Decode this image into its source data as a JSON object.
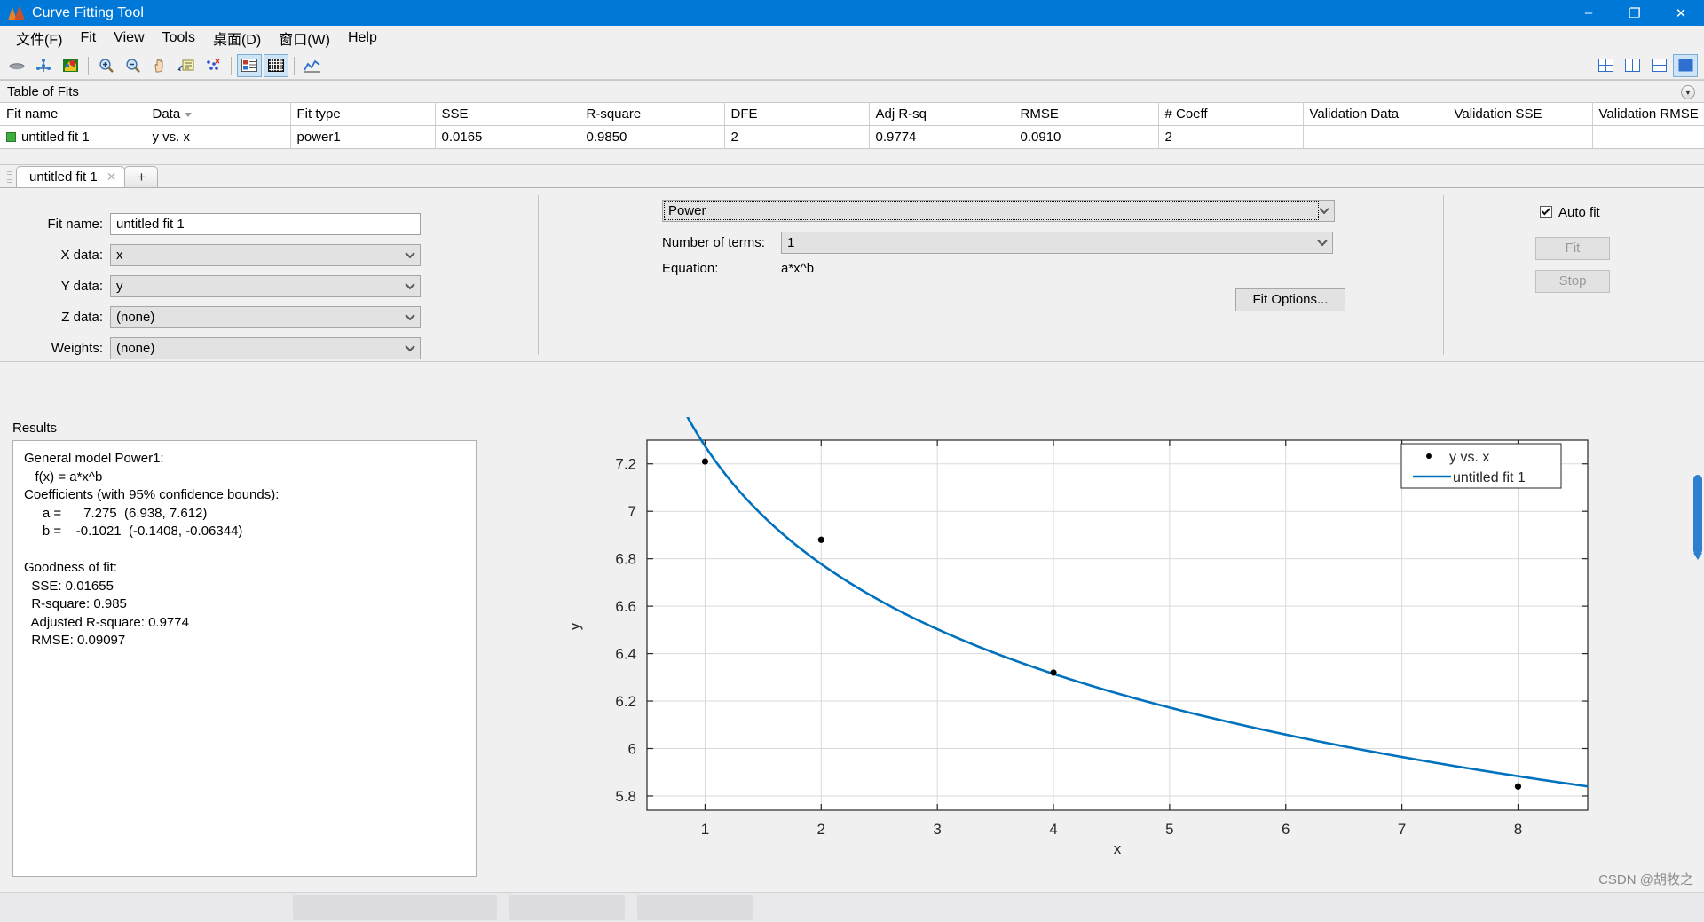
{
  "window": {
    "title": "Curve Fitting Tool",
    "icon": "matlab-icon",
    "minimize": "–",
    "maximize": "❐",
    "close": "✕"
  },
  "menubar": {
    "items": [
      {
        "label": "文件(F)",
        "name": "menu-file"
      },
      {
        "label": "Fit",
        "name": "menu-fit"
      },
      {
        "label": "View",
        "name": "menu-view"
      },
      {
        "label": "Tools",
        "name": "menu-tools"
      },
      {
        "label": "桌面(D)",
        "name": "menu-desktop"
      },
      {
        "label": "窗口(W)",
        "name": "menu-window"
      },
      {
        "label": "Help",
        "name": "menu-help"
      }
    ]
  },
  "toolbar": {
    "buttons": [
      "rotate-3d-icon",
      "data-cursor-icon",
      "colormap-icon",
      "zoom-in-icon",
      "zoom-out-icon",
      "pan-icon",
      "legend-icon",
      "exclude-outliers-icon",
      "table-of-fits-icon",
      "grid-icon",
      "residuals-plot-icon"
    ],
    "right_buttons": [
      "layout-grid-icon",
      "layout-two-columns-icon",
      "layout-two-rows-icon",
      "layout-single-icon"
    ]
  },
  "table_of_fits": {
    "panel_title": "Table of Fits",
    "collapse_icon": "chevron-down-icon",
    "columns": [
      "Fit name",
      "Data",
      "Fit type",
      "SSE",
      "R-square",
      "DFE",
      "Adj R-sq",
      "RMSE",
      "# Coeff",
      "Validation Data",
      "Validation SSE",
      "Validation RMSE"
    ],
    "sorted_column": "Data",
    "rows": [
      {
        "fit_name": "untitled fit 1",
        "data": "y vs. x",
        "fit_type": "power1",
        "sse": "0.0165",
        "r_square": "0.9850",
        "dfe": "2",
        "adj_r_sq": "0.9774",
        "rmse": "0.0910",
        "n_coeff": "2",
        "validation_data": "",
        "validation_sse": "",
        "validation_rmse": "",
        "swatch_color": "#3fae3f"
      }
    ]
  },
  "tabs": {
    "items": [
      {
        "label": "untitled fit 1",
        "close_icon": "close-icon"
      }
    ],
    "add_label": "+"
  },
  "fit_panel": {
    "fit_name_label": "Fit name:",
    "fit_name_value": "untitled fit 1",
    "x_data_label": "X data:",
    "x_data_value": "x",
    "y_data_label": "Y data:",
    "y_data_value": "y",
    "z_data_label": "Z data:",
    "z_data_value": "(none)",
    "weights_label": "Weights:",
    "weights_value": "(none)",
    "fit_type_value": "Power",
    "num_terms_label": "Number of terms:",
    "num_terms_value": "1",
    "equation_label": "Equation:",
    "equation_value": "a*x^b",
    "fit_options_label": "Fit Options...",
    "auto_fit_label": "Auto fit",
    "auto_fit_checked": true,
    "fit_button_label": "Fit",
    "stop_button_label": "Stop"
  },
  "results": {
    "title": "Results",
    "text": "General model Power1:\n   f(x) = a*x^b\nCoefficients (with 95% confidence bounds):\n     a =      7.275  (6.938, 7.612)\n     b =    -0.1021  (-0.1408, -0.06344)\n\nGoodness of fit:\n  SSE: 0.01655\n  R-square: 0.985\n  Adjusted R-square: 0.9774\n  RMSE: 0.09097"
  },
  "chart_data": {
    "type": "scatter",
    "title": "",
    "xlabel": "x",
    "ylabel": "y",
    "xlim": [
      0.5,
      8.6
    ],
    "ylim": [
      5.74,
      7.3
    ],
    "xticks": [
      1,
      2,
      3,
      4,
      5,
      6,
      7,
      8
    ],
    "yticks": [
      5.8,
      6,
      6.2,
      6.4,
      6.6,
      6.8,
      7,
      7.2
    ],
    "xticklabels": [
      "1",
      "2",
      "3",
      "4",
      "5",
      "6",
      "7",
      "8"
    ],
    "yticklabels": [
      "5.8",
      "6",
      "6.2",
      "6.4",
      "6.6",
      "6.8",
      "7",
      "7.2"
    ],
    "grid": true,
    "legend_position": "top-right",
    "series": [
      {
        "name": "y vs. x",
        "type": "scatter",
        "marker": "dot",
        "color": "#000000",
        "x": [
          1,
          2,
          4,
          8
        ],
        "y": [
          7.21,
          6.88,
          6.32,
          5.84
        ]
      },
      {
        "name": "untitled fit 1",
        "type": "line",
        "color": "#0072bd",
        "equation": "7.275*x^-0.1021",
        "coefficients": {
          "a": 7.275,
          "b": -0.1021
        }
      }
    ]
  },
  "watermark": "CSDN @胡牧之"
}
